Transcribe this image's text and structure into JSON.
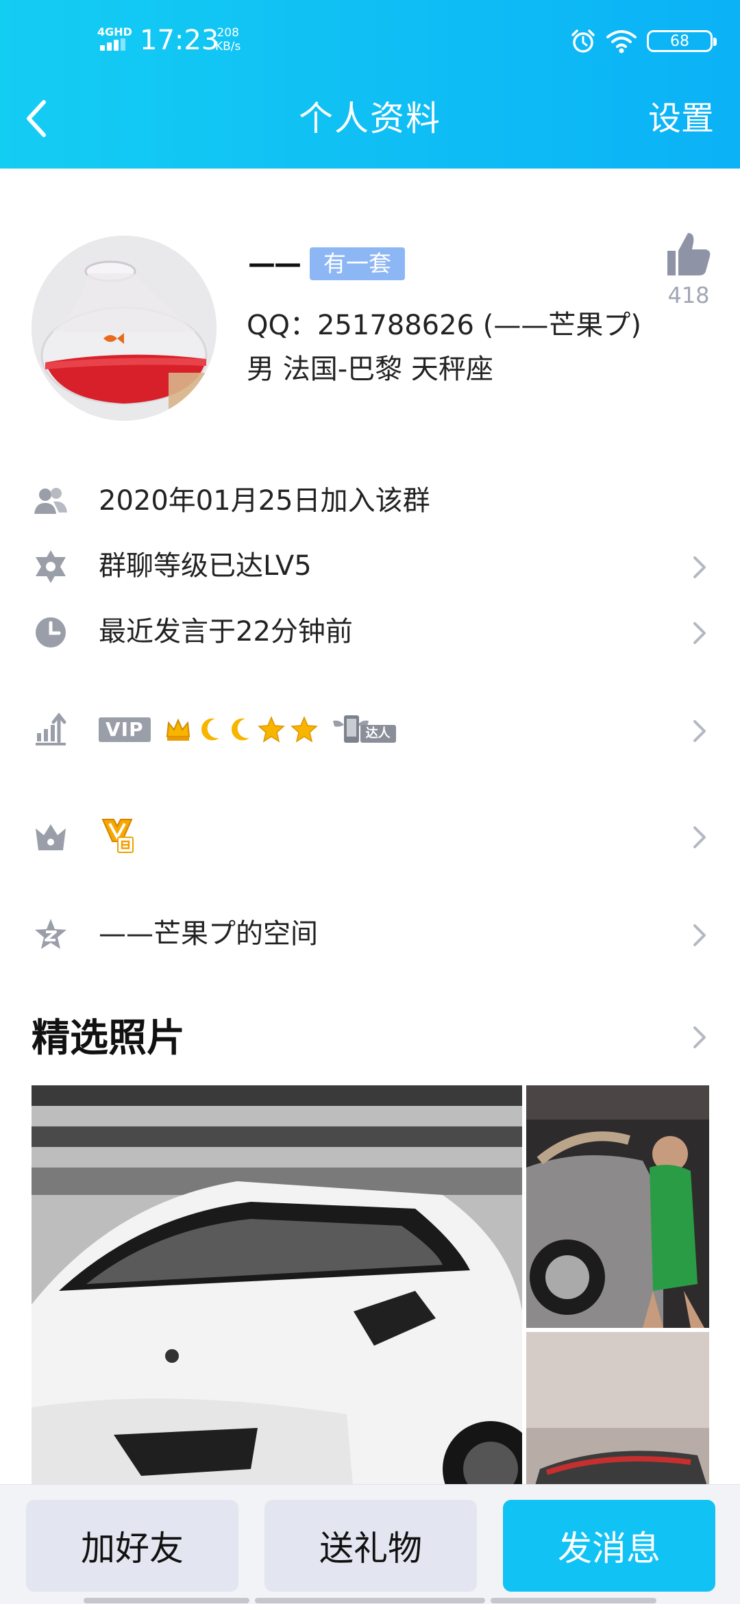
{
  "status_bar": {
    "network": "4GHD",
    "time": "17:23",
    "speed_value": "208",
    "speed_unit": "KB/s",
    "battery": "68"
  },
  "nav": {
    "title": "个人资料",
    "right_action": "设置"
  },
  "profile": {
    "name": "——",
    "badge": "有一套",
    "like_count": "418",
    "qq_line": "QQ：251788626 (——芒果プ)",
    "info_line": "男  法国-巴黎  天秤座"
  },
  "rows": {
    "join": "2020年01月25日加入该群",
    "level": "群聊等级已达LV5",
    "last_speak": "最近发言于22分钟前",
    "vip_tag": "VIP",
    "vip_talent": "达人",
    "space": "——芒果プ的空间"
  },
  "photos": {
    "title": "精选照片"
  },
  "actions": {
    "add_friend": "加好友",
    "send_gift": "送礼物",
    "send_message": "发消息"
  },
  "colors": {
    "header_start": "#14cdf3",
    "header_end": "#0bb2f6",
    "primary_button": "#11c3f5",
    "icon_gray": "#9a9ea8"
  }
}
